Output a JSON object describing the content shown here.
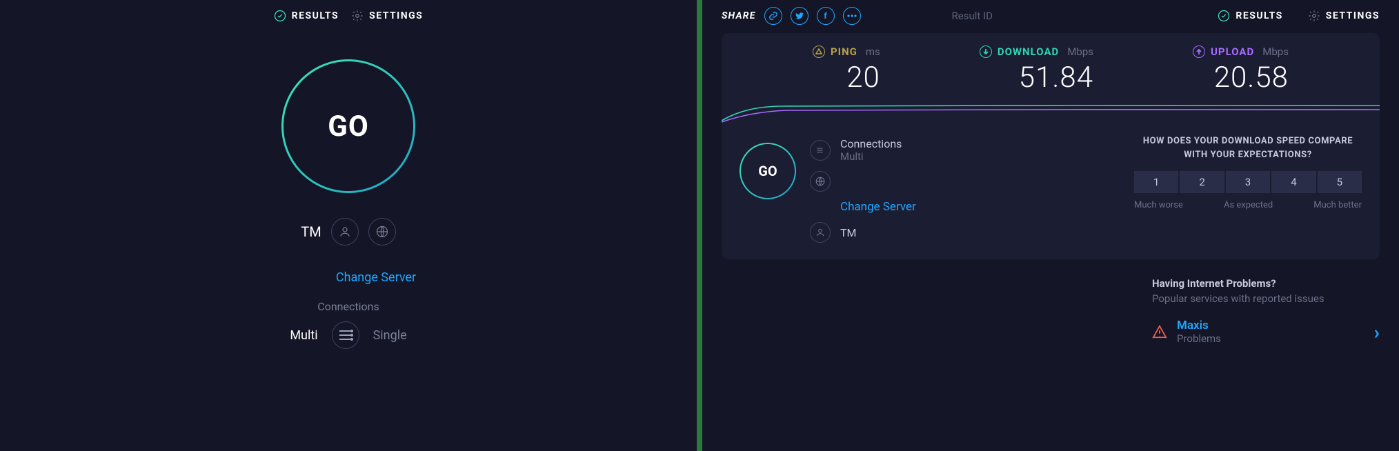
{
  "header": {
    "results": "RESULTS",
    "settings": "SETTINGS"
  },
  "s1": {
    "go": "GO",
    "isp": "TM",
    "change_server": "Change Server",
    "connections_label": "Connections",
    "multi": "Multi",
    "single": "Single"
  },
  "s2": {
    "share_label": "SHARE",
    "result_id_label": "Result ID",
    "metrics": {
      "ping": {
        "label": "PING",
        "unit": "ms",
        "value": "20"
      },
      "download": {
        "label": "DOWNLOAD",
        "unit": "Mbps",
        "value": "51.84"
      },
      "upload": {
        "label": "UPLOAD",
        "unit": "Mbps",
        "value": "20.58"
      }
    },
    "go": "GO",
    "connections_label": "Connections",
    "connections_value": "Multi",
    "change_server": "Change Server",
    "isp": "TM",
    "rating": {
      "question": "HOW DOES YOUR DOWNLOAD SPEED COMPARE WITH YOUR EXPECTATIONS?",
      "opts": [
        "1",
        "2",
        "3",
        "4",
        "5"
      ],
      "left": "Much worse",
      "mid": "As expected",
      "right": "Much better"
    },
    "problems": {
      "title": "Having Internet Problems?",
      "subtitle": "Popular services with reported issues",
      "item_name": "Maxis",
      "item_status": "Problems"
    }
  }
}
